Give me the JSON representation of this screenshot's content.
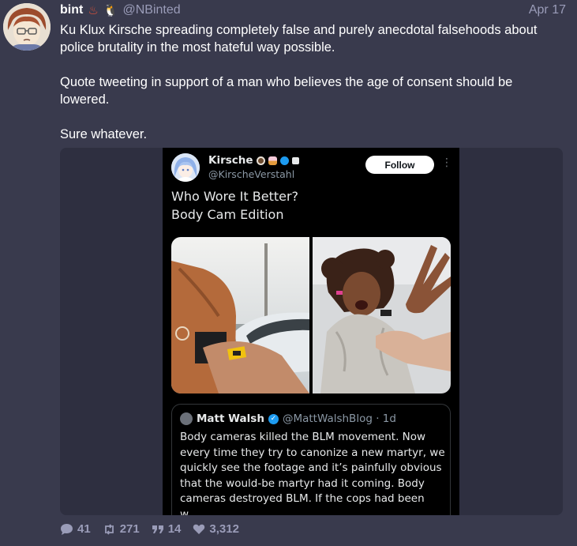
{
  "post": {
    "display_name": "bint",
    "name_emojis": [
      "♨",
      "🐧"
    ],
    "handle": "@NBinted",
    "date": "Apr 17",
    "paragraphs": [
      "Ku Klux Kirsche spreading completely false and purely anecdotal falsehoods about police brutality in the most hateful way possible.",
      "Quote tweeting in support of a man who believes the age of consent should be lowered.",
      "Sure whatever."
    ]
  },
  "embed": {
    "name": "Kirsche",
    "handle": "@KirscheVerstahl",
    "follow_label": "Follow",
    "more_glyph": "⋮",
    "text_lines": [
      "Who Wore It Better?",
      "Body Cam Edition"
    ],
    "quote": {
      "name": "Matt Walsh",
      "handle": "@MattWalshBlog · 1d",
      "text": "Body cameras killed the BLM movement. Now every time they try to canonize a new martyr, we quickly see the footage and it’s painfully obvious that the would-be martyr had it coming. Body cameras destroyed BLM. If the cops had been w..."
    }
  },
  "stats": {
    "replies": "41",
    "boosts": "271",
    "quotes": "14",
    "likes": "3,312"
  },
  "icons": {
    "reply": "speech-bubble-icon",
    "boost": "repost-icon",
    "quote": "quote-marks-icon",
    "like": "heart-icon"
  },
  "colors": {
    "background": "#393a4d",
    "muted": "#9a9cb8",
    "embed_frame": "#2e2f40",
    "tweet_bg": "#000000",
    "verified": "#1d9bf0"
  }
}
